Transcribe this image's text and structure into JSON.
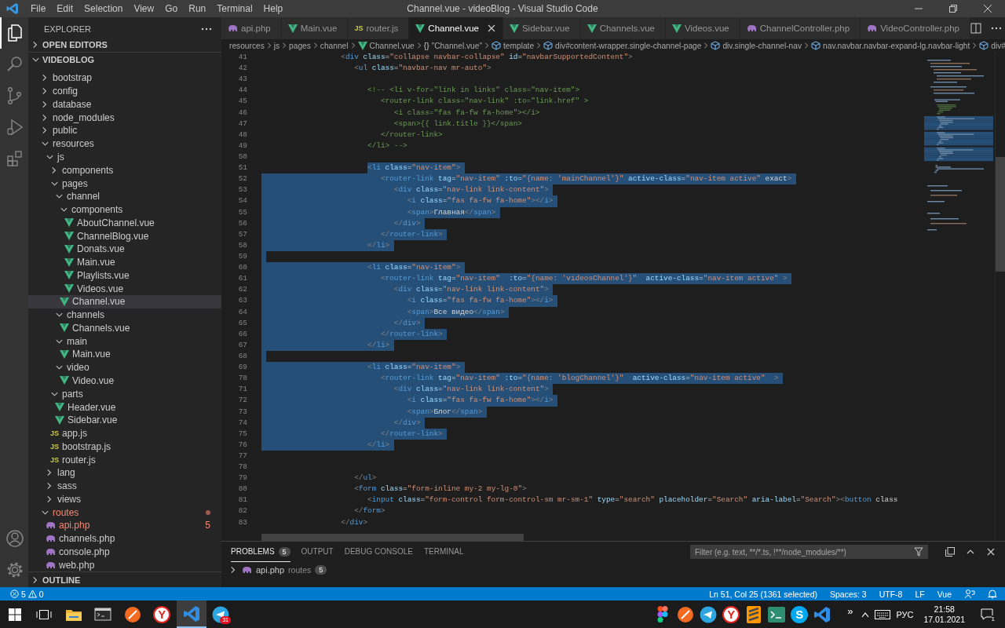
{
  "title_bar": {
    "menu": [
      "File",
      "Edit",
      "Selection",
      "View",
      "Go",
      "Run",
      "Terminal",
      "Help"
    ],
    "title": "Channel.vue - videoBlog - Visual Studio Code"
  },
  "activity_bar": {
    "items": [
      {
        "kind": "files",
        "selected": true
      },
      {
        "kind": "search",
        "selected": false
      },
      {
        "kind": "source-control",
        "selected": false
      },
      {
        "kind": "run",
        "selected": false
      },
      {
        "kind": "extensions",
        "selected": false
      }
    ],
    "bottom": [
      {
        "kind": "account"
      },
      {
        "kind": "settings"
      }
    ]
  },
  "explorer": {
    "header": "EXPLORER",
    "sections": [
      {
        "label": "OPEN EDITORS",
        "expanded": false
      },
      {
        "label": "VIDEOBLOG",
        "expanded": true
      }
    ],
    "tree": [
      {
        "label": "bootstrap",
        "kind": "folder",
        "expanded": false,
        "selected": false,
        "error": false
      },
      {
        "label": "config",
        "kind": "folder",
        "expanded": false,
        "selected": false,
        "error": false
      },
      {
        "label": "database",
        "kind": "folder",
        "expanded": false,
        "selected": false,
        "error": false
      },
      {
        "label": "node_modules",
        "kind": "folder",
        "expanded": false,
        "selected": false,
        "error": false
      },
      {
        "label": "public",
        "kind": "folder",
        "expanded": false,
        "selected": false,
        "error": false
      },
      {
        "label": "resources",
        "kind": "folder",
        "expanded": true,
        "selected": false,
        "error": false,
        "children": [
          {
            "label": "js",
            "kind": "folder",
            "expanded": true,
            "selected": false,
            "error": false,
            "children": [
              {
                "label": "components",
                "kind": "folder",
                "expanded": false,
                "selected": false,
                "error": false
              },
              {
                "label": "pages",
                "kind": "folder",
                "expanded": true,
                "selected": false,
                "error": false,
                "children": [
                  {
                    "label": "channel",
                    "kind": "folder",
                    "expanded": true,
                    "selected": false,
                    "error": false,
                    "children": [
                      {
                        "label": "components",
                        "kind": "folder",
                        "expanded": true,
                        "selected": false,
                        "error": false,
                        "children": [
                          {
                            "label": "AboutChannel.vue",
                            "kind": "vue",
                            "selected": false,
                            "error": false
                          },
                          {
                            "label": "ChannelBlog.vue",
                            "kind": "vue",
                            "selected": false,
                            "error": false
                          },
                          {
                            "label": "Donats.vue",
                            "kind": "vue",
                            "selected": false,
                            "error": false
                          },
                          {
                            "label": "Main.vue",
                            "kind": "vue",
                            "selected": false,
                            "error": false
                          },
                          {
                            "label": "Playlists.vue",
                            "kind": "vue",
                            "selected": false,
                            "error": false
                          },
                          {
                            "label": "Videos.vue",
                            "kind": "vue",
                            "selected": false,
                            "error": false
                          }
                        ]
                      },
                      {
                        "label": "Channel.vue",
                        "kind": "vue",
                        "selected": true,
                        "error": false
                      }
                    ]
                  },
                  {
                    "label": "channels",
                    "kind": "folder",
                    "expanded": true,
                    "selected": false,
                    "error": false,
                    "children": [
                      {
                        "label": "Channels.vue",
                        "kind": "vue",
                        "selected": false,
                        "error": false
                      }
                    ]
                  },
                  {
                    "label": "main",
                    "kind": "folder",
                    "expanded": true,
                    "selected": false,
                    "error": false,
                    "children": [
                      {
                        "label": "Main.vue",
                        "kind": "vue",
                        "selected": false,
                        "error": false
                      }
                    ]
                  },
                  {
                    "label": "video",
                    "kind": "folder",
                    "expanded": true,
                    "selected": false,
                    "error": false,
                    "children": [
                      {
                        "label": "Video.vue",
                        "kind": "vue",
                        "selected": false,
                        "error": false
                      }
                    ]
                  }
                ]
              },
              {
                "label": "parts",
                "kind": "folder",
                "expanded": true,
                "selected": false,
                "error": false,
                "children": [
                  {
                    "label": "Header.vue",
                    "kind": "vue",
                    "selected": false,
                    "error": false
                  },
                  {
                    "label": "Sidebar.vue",
                    "kind": "vue",
                    "selected": false,
                    "error": false
                  }
                ]
              },
              {
                "label": "app.js",
                "kind": "js",
                "icon_text": "JS",
                "selected": false,
                "error": false
              },
              {
                "label": "bootstrap.js",
                "kind": "js",
                "icon_text": "JS",
                "selected": false,
                "error": false
              },
              {
                "label": "router.js",
                "kind": "js",
                "icon_text": "JS",
                "selected": false,
                "error": false
              }
            ]
          },
          {
            "label": "lang",
            "kind": "folder",
            "expanded": false,
            "selected": false,
            "error": false
          },
          {
            "label": "sass",
            "kind": "folder",
            "expanded": false,
            "selected": false,
            "error": false
          },
          {
            "label": "views",
            "kind": "folder",
            "expanded": false,
            "selected": false,
            "error": false
          }
        ]
      },
      {
        "label": "routes",
        "kind": "folder",
        "expanded": true,
        "selected": false,
        "error": true,
        "children": [
          {
            "label": "api.php",
            "kind": "php",
            "selected": false,
            "error": true,
            "badge": "5"
          },
          {
            "label": "channels.php",
            "kind": "php",
            "selected": false,
            "error": false
          },
          {
            "label": "console.php",
            "kind": "php",
            "selected": false,
            "error": false
          },
          {
            "label": "web.php",
            "kind": "php",
            "selected": false,
            "error": false
          }
        ]
      }
    ],
    "outline": {
      "label": "OUTLINE",
      "expanded": false
    }
  },
  "tabs": [
    {
      "label": "api.php",
      "kind": "php",
      "selected": false
    },
    {
      "label": "Main.vue",
      "kind": "vue",
      "selected": false
    },
    {
      "label": "router.js",
      "kind": "js",
      "icon_text": "JS",
      "selected": false
    },
    {
      "label": "Channel.vue",
      "kind": "vue",
      "selected": true
    },
    {
      "label": "Sidebar.vue",
      "kind": "vue",
      "selected": false
    },
    {
      "label": "Channels.vue",
      "kind": "vue",
      "selected": false
    },
    {
      "label": "Videos.vue",
      "kind": "vue",
      "selected": false
    },
    {
      "label": "ChannelController.php",
      "kind": "php",
      "selected": false
    },
    {
      "label": "VideoController.php",
      "kind": "php",
      "selected": false
    }
  ],
  "breadcrumbs": [
    {
      "label": "resources",
      "kind": "folder"
    },
    {
      "label": "js",
      "kind": "folder"
    },
    {
      "label": "pages",
      "kind": "folder"
    },
    {
      "label": "channel",
      "kind": "folder"
    },
    {
      "label": "Channel.vue",
      "kind": "vue"
    },
    {
      "label": "\"Channel.vue\"",
      "kind": "braces",
      "icon_text": "{}"
    },
    {
      "label": "template",
      "kind": "element"
    },
    {
      "label": "div#content-wrapper.single-channel-page",
      "kind": "element"
    },
    {
      "label": "div.single-channel-nav",
      "kind": "element"
    },
    {
      "label": "nav.navbar.navbar-expand-lg.navbar-light",
      "kind": "element"
    },
    {
      "label": "div#",
      "kind": "element"
    }
  ],
  "editor": {
    "lines": [
      {
        "number": "41",
        "kind": "code",
        "selected": false,
        "text": "                  <div class=\"collapse navbar-collapse\" id=\"navbarSupportedContent\">"
      },
      {
        "number": "42",
        "kind": "code",
        "selected": false,
        "text": "                     <ul class=\"navbar-nav mr-auto\">"
      },
      {
        "number": "43",
        "selected": false
      },
      {
        "number": "44",
        "kind": "comment",
        "selected": false,
        "text": "                        <!-- <li v-for=\"link in links\" class=\"nav-item\">"
      },
      {
        "number": "45",
        "kind": "comment",
        "selected": false,
        "text": "                           <router-link class=\"nav-link\" :to=\"link.href\" >"
      },
      {
        "number": "46",
        "kind": "comment",
        "selected": false,
        "text": "                              <i class=\"fas fa-fw fa-home\"></i>"
      },
      {
        "number": "47",
        "kind": "comment",
        "selected": false,
        "text": "                              <span>{{ link.title }}</span>"
      },
      {
        "number": "48",
        "kind": "comment",
        "selected": false,
        "text": "                           </router-link>"
      },
      {
        "number": "49",
        "kind": "comment",
        "selected": false,
        "text": "                        </li> -->"
      },
      {
        "number": "50",
        "selected": false
      },
      {
        "number": "51",
        "kind": "code",
        "selected": true,
        "text": "                        <li class=\"nav-item\">"
      },
      {
        "number": "52",
        "kind": "code",
        "selected": true,
        "text": "                           <router-link tag=\"nav-item\" :to=\"{name: 'mainChannel'}\" active-class=\"nav-item active\" exact>"
      },
      {
        "number": "53",
        "kind": "code",
        "selected": true,
        "text": "                              <div class=\"nav-link link-content\">"
      },
      {
        "number": "54",
        "kind": "code",
        "selected": true,
        "text": "                                 <i class=\"fas fa-fw fa-home\"></i>"
      },
      {
        "number": "55",
        "kind": "code",
        "selected": true,
        "text": "                                 <span>Главная</span>"
      },
      {
        "number": "56",
        "kind": "code",
        "selected": true,
        "text": "                              </div>"
      },
      {
        "number": "57",
        "kind": "code",
        "selected": true,
        "text": "                           </router-link>"
      },
      {
        "number": "58",
        "kind": "code",
        "selected": true,
        "text": "                        </li>"
      },
      {
        "number": "59",
        "selected": true
      },
      {
        "number": "60",
        "kind": "code",
        "selected": true,
        "text": "                        <li class=\"nav-item\">"
      },
      {
        "number": "61",
        "kind": "code",
        "selected": true,
        "text": "                           <router-link tag=\"nav-item\"  :to=\"{name: 'videosChannel'}\"  active-class=\"nav-item active\" >"
      },
      {
        "number": "62",
        "kind": "code",
        "selected": true,
        "text": "                              <div class=\"nav-link link-content\">"
      },
      {
        "number": "63",
        "kind": "code",
        "selected": true,
        "text": "                                 <i class=\"fas fa-fw fa-home\"></i>"
      },
      {
        "number": "64",
        "kind": "code",
        "selected": true,
        "text": "                                 <span>Все видео</span>"
      },
      {
        "number": "65",
        "kind": "code",
        "selected": true,
        "text": "                              </div>"
      },
      {
        "number": "66",
        "kind": "code",
        "selected": true,
        "text": "                           </router-link>"
      },
      {
        "number": "67",
        "kind": "code",
        "selected": true,
        "text": "                        </li>"
      },
      {
        "number": "68",
        "selected": true
      },
      {
        "number": "69",
        "kind": "code",
        "selected": true,
        "text": "                        <li class=\"nav-item\">"
      },
      {
        "number": "70",
        "kind": "code",
        "selected": true,
        "text": "                           <router-link tag=\"nav-item\" :to=\"{name: 'blogChannel'}\"  active-class=\"nav-item active\"  >"
      },
      {
        "number": "71",
        "kind": "code",
        "selected": true,
        "text": "                              <div class=\"nav-link link-content\">"
      },
      {
        "number": "72",
        "kind": "code",
        "selected": true,
        "text": "                                 <i class=\"fas fa-fw fa-home\"></i>"
      },
      {
        "number": "73",
        "kind": "code",
        "selected": true,
        "text": "                                 <span>Блог</span>"
      },
      {
        "number": "74",
        "kind": "code",
        "selected": true,
        "text": "                              </div>"
      },
      {
        "number": "75",
        "kind": "code",
        "selected": true,
        "text": "                           </router-link>"
      },
      {
        "number": "76",
        "kind": "code",
        "selected": true,
        "text": "                        </li>"
      },
      {
        "number": "77",
        "selected": false
      },
      {
        "number": "78",
        "selected": false
      },
      {
        "number": "79",
        "kind": "code",
        "selected": false,
        "text": "                     </ul>"
      },
      {
        "number": "80",
        "kind": "code",
        "selected": false,
        "text": "                     <form class=\"form-inline my-2 my-lg-0\">"
      },
      {
        "number": "81",
        "kind": "code",
        "selected": false,
        "text": "                        <input class=\"form-control form-control-sm mr-sm-1\" type=\"search\" placeholder=\"Search\" aria-label=\"Search\"><button class"
      },
      {
        "number": "82",
        "kind": "code",
        "selected": false,
        "text": "                     </form>"
      },
      {
        "number": "83",
        "kind": "code",
        "selected": false,
        "text": "                  </div>"
      }
    ]
  },
  "panel": {
    "tabs": [
      {
        "label": "PROBLEMS",
        "selected": true,
        "badge": "5"
      },
      {
        "label": "OUTPUT",
        "selected": false
      },
      {
        "label": "DEBUG CONSOLE",
        "selected": false
      },
      {
        "label": "TERMINAL",
        "selected": false
      }
    ],
    "filter": {
      "placeholder": "Filter (e.g. text, **/*.ts, !**/node_modules/**)"
    },
    "problems": [
      {
        "file": "api.php",
        "folder": "routes",
        "count": "5",
        "expanded": false
      }
    ]
  },
  "status_bar": {
    "errors": "5",
    "warnings": "0",
    "items": [
      "Ln 51, Col 25 (1361 selected)",
      "Spaces: 3",
      "UTF-8",
      "LF",
      "Vue"
    ]
  },
  "taskbar": {
    "apps": [
      {
        "kind": "start",
        "selected": false
      },
      {
        "kind": "task-view",
        "selected": false
      },
      {
        "kind": "folder",
        "selected": false
      },
      {
        "kind": "console",
        "selected": false
      },
      {
        "kind": "compass",
        "selected": false
      },
      {
        "kind": "browser",
        "icon_text": "Y",
        "selected": false
      },
      {
        "kind": "vscode",
        "selected": true
      },
      {
        "kind": "telegram",
        "badge": "31",
        "selected": false
      }
    ],
    "tray": [
      {
        "kind": "figma"
      },
      {
        "kind": "compass"
      },
      {
        "kind": "telegram"
      },
      {
        "kind": "browser",
        "icon_text": "Y"
      },
      {
        "kind": "sublime"
      },
      {
        "kind": "terminal"
      },
      {
        "kind": "skype",
        "icon_text": "S"
      },
      {
        "kind": "vscode"
      }
    ],
    "overflow": "»",
    "language": "РУС",
    "time": "21:58",
    "date": "17.01.2021",
    "notifications": "1"
  }
}
